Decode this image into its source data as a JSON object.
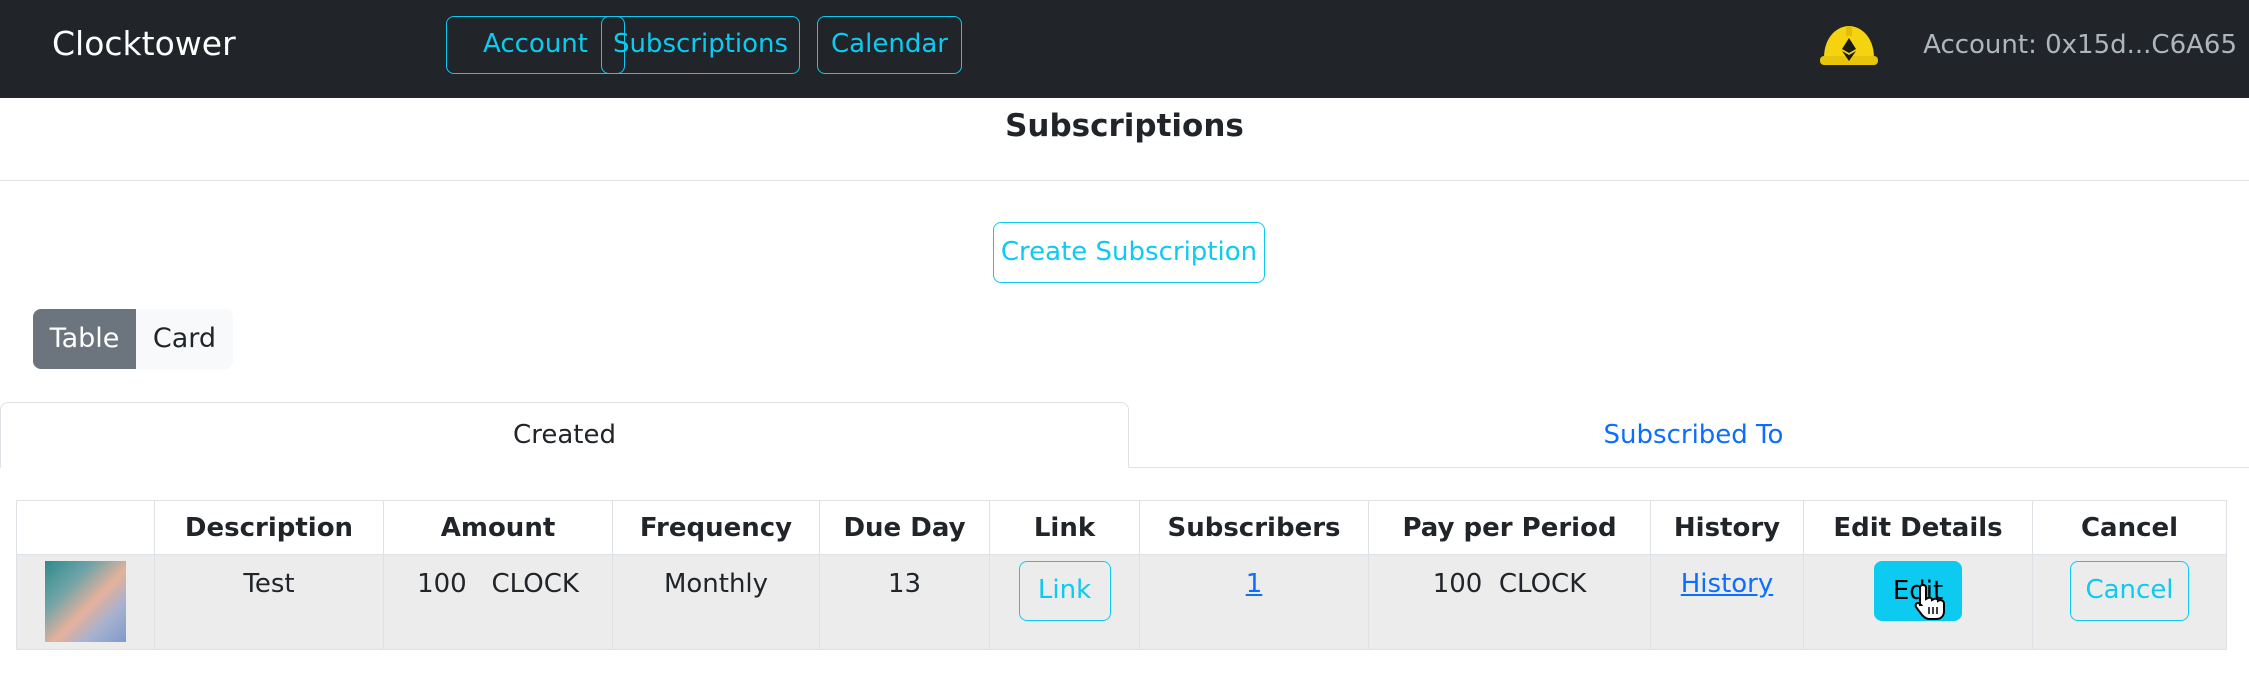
{
  "navbar": {
    "brand": "Clocktower",
    "buttons": [
      {
        "label": "Account"
      },
      {
        "label": "Subscriptions"
      },
      {
        "label": "Calendar"
      }
    ],
    "account_text": "Account: 0x15d...C6A65",
    "icon": "metamask-helmet-icon"
  },
  "page": {
    "title": "Subscriptions",
    "create_button": "Create Subscription",
    "view_toggle": {
      "options": [
        "Table",
        "Card"
      ],
      "selected": "Table"
    },
    "tabs": [
      {
        "label": "Created",
        "active": true
      },
      {
        "label": "Subscribed To",
        "active": false
      }
    ]
  },
  "table": {
    "headers": [
      "",
      "Description",
      "Amount",
      "Frequency",
      "Due Day",
      "Link",
      "Subscribers",
      "Pay per Period",
      "History",
      "Edit Details",
      "Cancel"
    ],
    "rows": [
      {
        "description": "Test",
        "amount": "100   CLOCK",
        "frequency": "Monthly",
        "due_day": "13",
        "link_button": "Link",
        "subscribers": "1",
        "pay_per_period": "100  CLOCK",
        "history_link": "History",
        "edit_button": "Edit",
        "cancel_button": "Cancel"
      }
    ]
  },
  "colors": {
    "navbar_bg": "#212529",
    "accent_info": "#0dcaf0",
    "link_blue": "#0d6efd",
    "toggle_active": "#6c757d",
    "row_bg": "#ececec",
    "helmet_yellow": "#f5d311"
  }
}
